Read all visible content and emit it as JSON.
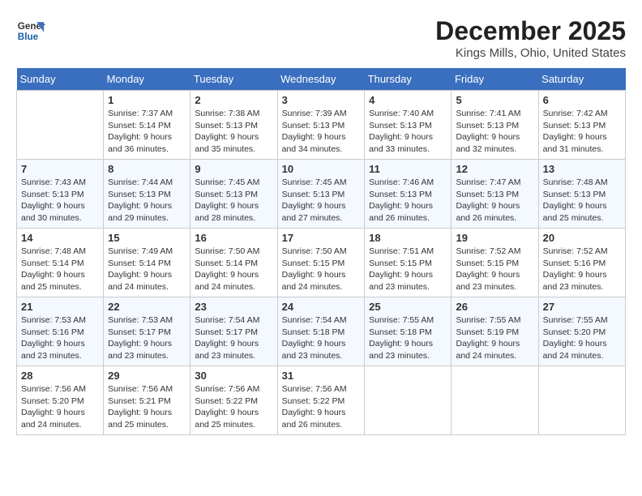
{
  "header": {
    "logo_line1": "General",
    "logo_line2": "Blue",
    "month": "December 2025",
    "location": "Kings Mills, Ohio, United States"
  },
  "days_of_week": [
    "Sunday",
    "Monday",
    "Tuesday",
    "Wednesday",
    "Thursday",
    "Friday",
    "Saturday"
  ],
  "weeks": [
    [
      {
        "num": "",
        "info": ""
      },
      {
        "num": "1",
        "info": "Sunrise: 7:37 AM\nSunset: 5:14 PM\nDaylight: 9 hours\nand 36 minutes."
      },
      {
        "num": "2",
        "info": "Sunrise: 7:38 AM\nSunset: 5:13 PM\nDaylight: 9 hours\nand 35 minutes."
      },
      {
        "num": "3",
        "info": "Sunrise: 7:39 AM\nSunset: 5:13 PM\nDaylight: 9 hours\nand 34 minutes."
      },
      {
        "num": "4",
        "info": "Sunrise: 7:40 AM\nSunset: 5:13 PM\nDaylight: 9 hours\nand 33 minutes."
      },
      {
        "num": "5",
        "info": "Sunrise: 7:41 AM\nSunset: 5:13 PM\nDaylight: 9 hours\nand 32 minutes."
      },
      {
        "num": "6",
        "info": "Sunrise: 7:42 AM\nSunset: 5:13 PM\nDaylight: 9 hours\nand 31 minutes."
      }
    ],
    [
      {
        "num": "7",
        "info": "Sunrise: 7:43 AM\nSunset: 5:13 PM\nDaylight: 9 hours\nand 30 minutes."
      },
      {
        "num": "8",
        "info": "Sunrise: 7:44 AM\nSunset: 5:13 PM\nDaylight: 9 hours\nand 29 minutes."
      },
      {
        "num": "9",
        "info": "Sunrise: 7:45 AM\nSunset: 5:13 PM\nDaylight: 9 hours\nand 28 minutes."
      },
      {
        "num": "10",
        "info": "Sunrise: 7:45 AM\nSunset: 5:13 PM\nDaylight: 9 hours\nand 27 minutes."
      },
      {
        "num": "11",
        "info": "Sunrise: 7:46 AM\nSunset: 5:13 PM\nDaylight: 9 hours\nand 26 minutes."
      },
      {
        "num": "12",
        "info": "Sunrise: 7:47 AM\nSunset: 5:13 PM\nDaylight: 9 hours\nand 26 minutes."
      },
      {
        "num": "13",
        "info": "Sunrise: 7:48 AM\nSunset: 5:13 PM\nDaylight: 9 hours\nand 25 minutes."
      }
    ],
    [
      {
        "num": "14",
        "info": "Sunrise: 7:48 AM\nSunset: 5:14 PM\nDaylight: 9 hours\nand 25 minutes."
      },
      {
        "num": "15",
        "info": "Sunrise: 7:49 AM\nSunset: 5:14 PM\nDaylight: 9 hours\nand 24 minutes."
      },
      {
        "num": "16",
        "info": "Sunrise: 7:50 AM\nSunset: 5:14 PM\nDaylight: 9 hours\nand 24 minutes."
      },
      {
        "num": "17",
        "info": "Sunrise: 7:50 AM\nSunset: 5:15 PM\nDaylight: 9 hours\nand 24 minutes."
      },
      {
        "num": "18",
        "info": "Sunrise: 7:51 AM\nSunset: 5:15 PM\nDaylight: 9 hours\nand 23 minutes."
      },
      {
        "num": "19",
        "info": "Sunrise: 7:52 AM\nSunset: 5:15 PM\nDaylight: 9 hours\nand 23 minutes."
      },
      {
        "num": "20",
        "info": "Sunrise: 7:52 AM\nSunset: 5:16 PM\nDaylight: 9 hours\nand 23 minutes."
      }
    ],
    [
      {
        "num": "21",
        "info": "Sunrise: 7:53 AM\nSunset: 5:16 PM\nDaylight: 9 hours\nand 23 minutes."
      },
      {
        "num": "22",
        "info": "Sunrise: 7:53 AM\nSunset: 5:17 PM\nDaylight: 9 hours\nand 23 minutes."
      },
      {
        "num": "23",
        "info": "Sunrise: 7:54 AM\nSunset: 5:17 PM\nDaylight: 9 hours\nand 23 minutes."
      },
      {
        "num": "24",
        "info": "Sunrise: 7:54 AM\nSunset: 5:18 PM\nDaylight: 9 hours\nand 23 minutes."
      },
      {
        "num": "25",
        "info": "Sunrise: 7:55 AM\nSunset: 5:18 PM\nDaylight: 9 hours\nand 23 minutes."
      },
      {
        "num": "26",
        "info": "Sunrise: 7:55 AM\nSunset: 5:19 PM\nDaylight: 9 hours\nand 24 minutes."
      },
      {
        "num": "27",
        "info": "Sunrise: 7:55 AM\nSunset: 5:20 PM\nDaylight: 9 hours\nand 24 minutes."
      }
    ],
    [
      {
        "num": "28",
        "info": "Sunrise: 7:56 AM\nSunset: 5:20 PM\nDaylight: 9 hours\nand 24 minutes."
      },
      {
        "num": "29",
        "info": "Sunrise: 7:56 AM\nSunset: 5:21 PM\nDaylight: 9 hours\nand 25 minutes."
      },
      {
        "num": "30",
        "info": "Sunrise: 7:56 AM\nSunset: 5:22 PM\nDaylight: 9 hours\nand 25 minutes."
      },
      {
        "num": "31",
        "info": "Sunrise: 7:56 AM\nSunset: 5:22 PM\nDaylight: 9 hours\nand 26 minutes."
      },
      {
        "num": "",
        "info": ""
      },
      {
        "num": "",
        "info": ""
      },
      {
        "num": "",
        "info": ""
      }
    ]
  ]
}
